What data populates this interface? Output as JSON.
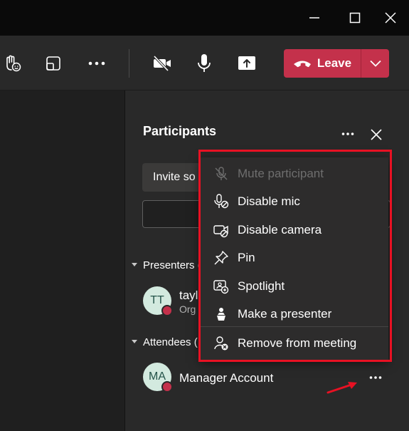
{
  "titlebar": {
    "minimize_icon": "minimize-icon",
    "maximize_icon": "maximize-icon",
    "close_icon": "close-icon"
  },
  "toolbar": {
    "raise_hand_icon": "raise-hand-icon",
    "share_tray_icon": "popout-icon",
    "more_icon": "more-icon",
    "camera_icon": "camera-off-icon",
    "mic_icon": "mic-icon",
    "share_icon": "share-icon",
    "leave_label": "Leave",
    "leave_icon": "phone-hangup-icon",
    "leave_options_icon": "chevron-down-icon",
    "leave_color": "#c4314b"
  },
  "participants_panel": {
    "title": "Participants",
    "invite_label": "Invite so",
    "presenters_label": "Presenters (",
    "attendees_label": "Attendees (",
    "presenters": [
      {
        "initials": "TT",
        "name": "tayl",
        "role": "Org"
      }
    ],
    "attendees": [
      {
        "initials": "MA",
        "name": "Manager Account"
      }
    ]
  },
  "context_menu": {
    "items": [
      {
        "label": "Mute participant",
        "icon": "mic-off-icon",
        "disabled": true
      },
      {
        "label": "Disable mic",
        "icon": "mic-disable-icon",
        "disabled": false
      },
      {
        "label": "Disable camera",
        "icon": "camera-disable-icon",
        "disabled": false
      },
      {
        "label": "Pin",
        "icon": "pin-icon",
        "disabled": false
      },
      {
        "label": "Spotlight",
        "icon": "spotlight-icon",
        "disabled": false
      },
      {
        "label": "Make a presenter",
        "icon": "presenter-icon",
        "disabled": false
      },
      {
        "label": "Remove from meeting",
        "icon": "remove-person-icon",
        "disabled": false
      }
    ],
    "highlight_color": "#e81123"
  }
}
